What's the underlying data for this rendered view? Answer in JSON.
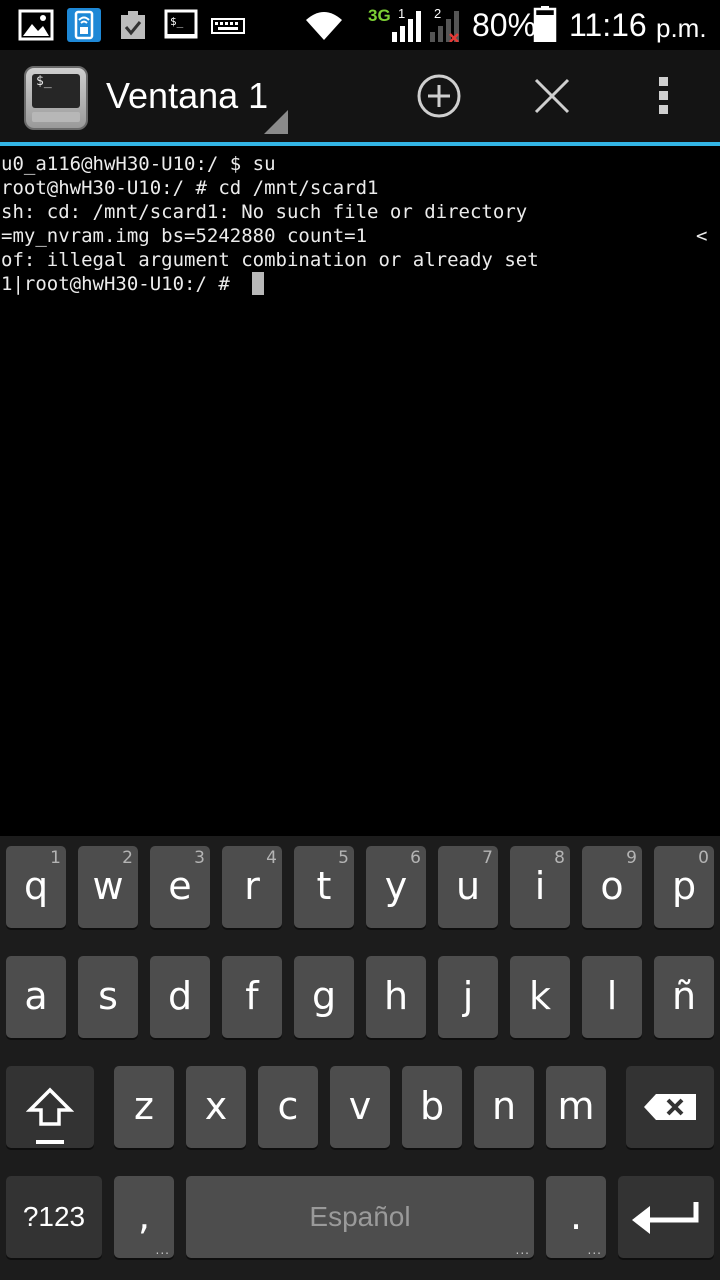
{
  "status_bar": {
    "network_label": "3G",
    "sim1_label": "1",
    "sim2_label": "2",
    "battery": "80%",
    "time_digits": "11:16",
    "time_suffix": "p.m.",
    "icons": [
      "gallery-icon",
      "sim-card-icon",
      "task-done-icon",
      "terminal-icon",
      "keyboard-icon",
      "wifi-icon",
      "signal-sim1-icon",
      "signal-sim2-no-service-icon",
      "battery-icon"
    ]
  },
  "action_bar": {
    "title": "Ventana 1",
    "icons": [
      "terminal-app-icon",
      "add-window-icon",
      "close-window-icon",
      "overflow-menu-icon"
    ]
  },
  "terminal": {
    "lines": [
      "u0_a116@hwH30-U10:/ $ su",
      "root@hwH30-U10:/ # cd /mnt/scard1",
      "sh: cd: /mnt/scard1: No such file or directory",
      "=my_nvram.img bs=5242880 count=1",
      "of: illegal argument combination or already set",
      "1|root@hwH30-U10:/ # "
    ],
    "line3_overflow_marker": "<"
  },
  "keyboard": {
    "row1": [
      {
        "char": "q",
        "hint": "1"
      },
      {
        "char": "w",
        "hint": "2"
      },
      {
        "char": "e",
        "hint": "3"
      },
      {
        "char": "r",
        "hint": "4"
      },
      {
        "char": "t",
        "hint": "5"
      },
      {
        "char": "y",
        "hint": "6"
      },
      {
        "char": "u",
        "hint": "7"
      },
      {
        "char": "i",
        "hint": "8"
      },
      {
        "char": "o",
        "hint": "9"
      },
      {
        "char": "p",
        "hint": "0"
      }
    ],
    "row2": [
      "a",
      "s",
      "d",
      "f",
      "g",
      "h",
      "j",
      "k",
      "l",
      "ñ"
    ],
    "row3": [
      "z",
      "x",
      "c",
      "v",
      "b",
      "n",
      "m"
    ],
    "symbols_label": "?123",
    "comma_label": ",",
    "space_label": "Español",
    "period_label": ".",
    "more_dots": "..."
  }
}
